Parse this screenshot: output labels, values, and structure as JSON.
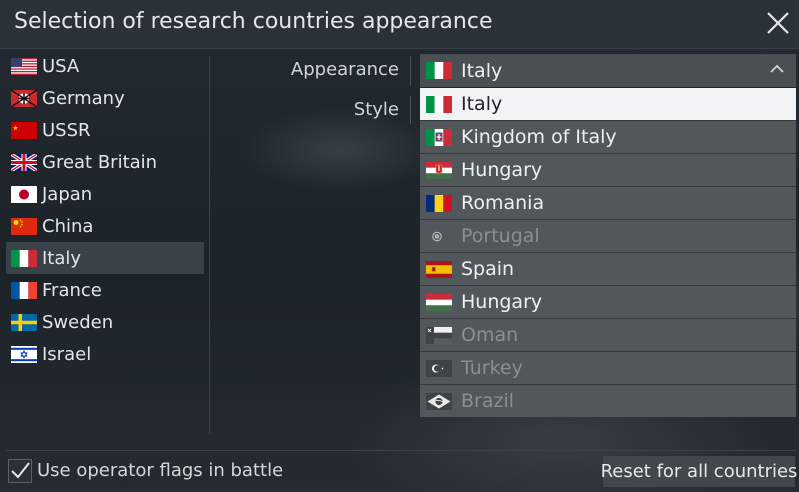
{
  "dialog": {
    "title": "Selection of research countries appearance"
  },
  "countries": [
    {
      "label": "USA",
      "flag": "usa-flag"
    },
    {
      "label": "Germany",
      "flag": "germany-flag"
    },
    {
      "label": "USSR",
      "flag": "ussr-flag"
    },
    {
      "label": "Great Britain",
      "flag": "great-britain-flag"
    },
    {
      "label": "Japan",
      "flag": "japan-flag"
    },
    {
      "label": "China",
      "flag": "china-flag"
    },
    {
      "label": "Italy",
      "flag": "italy-flag",
      "selected": true
    },
    {
      "label": "France",
      "flag": "france-flag"
    },
    {
      "label": "Sweden",
      "flag": "sweden-flag"
    },
    {
      "label": "Israel",
      "flag": "israel-flag"
    }
  ],
  "settings": {
    "appearance_label": "Appearance",
    "style_label": "Style",
    "appearance_value": "Italy",
    "appearance_flag": "italy-flag"
  },
  "appearance_options": [
    {
      "label": "Italy",
      "flag": "italy-flag",
      "selected": true,
      "enabled": true
    },
    {
      "label": "Kingdom of Italy",
      "flag": "kingdom-of-italy-flag",
      "enabled": true
    },
    {
      "label": "Hungary",
      "flag": "hungary-crest-flag",
      "enabled": true
    },
    {
      "label": "Romania",
      "flag": "romania-flag",
      "enabled": true
    },
    {
      "label": "Portugal",
      "flag": "portugal-flag",
      "enabled": false
    },
    {
      "label": "Spain",
      "flag": "spain-flag",
      "enabled": true
    },
    {
      "label": "Hungary",
      "flag": "hungary-flag",
      "enabled": true
    },
    {
      "label": "Oman",
      "flag": "oman-flag",
      "enabled": false
    },
    {
      "label": "Turkey",
      "flag": "turkey-flag",
      "enabled": false
    },
    {
      "label": "Brazil",
      "flag": "brazil-flag",
      "enabled": false
    }
  ],
  "footer": {
    "checkbox_label": "Use operator flags in battle",
    "checkbox_checked": true,
    "reset_label": "Reset for all countries"
  }
}
